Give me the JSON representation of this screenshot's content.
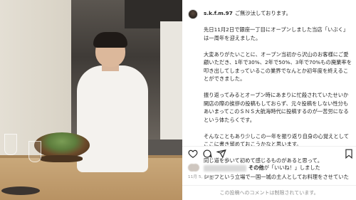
{
  "post": {
    "username": "s.k.f.m.97",
    "caption_paragraphs": [
      "ご無沙汰しております。",
      "先日11月2日で銀座一丁目にオープンしました当店「いぶく」は一周年を迎えました。",
      "大変ありがたいことに、オープン当初から沢山のお客様にご愛顧いただき、1年で30%、2年で50%、3年で70%もの廃業率を叩き出してしまっているこの業界でなんとか初年度を終えることができました。",
      "振り返ってみるとオープン時にあまりに忙殺されていたせいか開店の際の挨拶の投稿もしておらず、元々投稿をしない性分もあいまってこのＳＮＳ大航海時代に投稿するのが一苦労になるという体たらくです。",
      "そんなこともあり少しこの一年を振り返り自身の心覚えとしてここに書き留めておこうかなと思います。",
      "同じ道を歩いて初めて感じるものがあると思って。",
      "シェフという立場で一国一城の主人としてお料理をさせていた"
    ],
    "likes_text": "その他",
    "likes_suffix": "が「いいね！」しました",
    "date": "11月 5, 2022",
    "comments_disabled": "この投稿へのコメントは制限されています。"
  },
  "icons": {
    "like": "heart-icon",
    "comment": "comment-icon",
    "share": "share-icon",
    "save": "bookmark-icon"
  }
}
